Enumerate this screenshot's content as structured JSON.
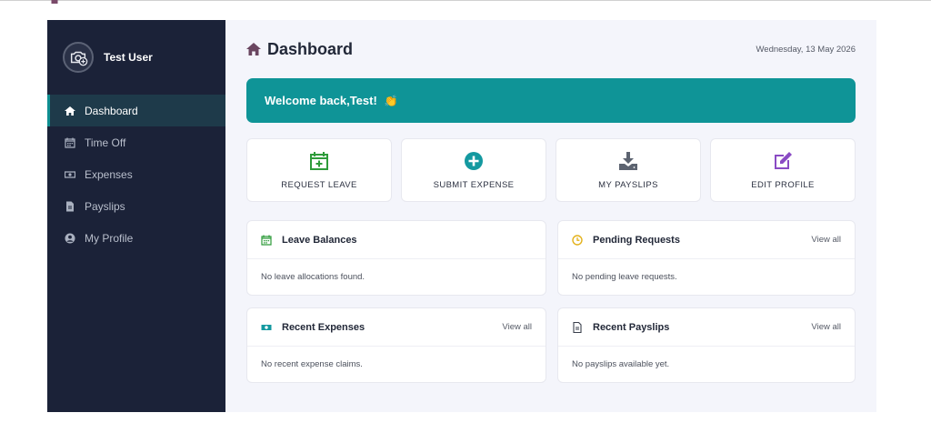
{
  "sidebar": {
    "user_name": "Test User",
    "items": [
      {
        "label": "Dashboard",
        "icon": "home-icon",
        "active": true
      },
      {
        "label": "Time Off",
        "icon": "calendar-icon",
        "active": false
      },
      {
        "label": "Expenses",
        "icon": "money-icon",
        "active": false
      },
      {
        "label": "Payslips",
        "icon": "document-icon",
        "active": false
      },
      {
        "label": "My Profile",
        "icon": "user-circle-icon",
        "active": false
      }
    ]
  },
  "header": {
    "title": "Dashboard",
    "date": "Wednesday, 13 May 2026"
  },
  "welcome": {
    "text": "Welcome back,Test!",
    "emoji": "👏"
  },
  "actions": [
    {
      "label": "REQUEST LEAVE",
      "icon": "calendar-plus-icon",
      "color": "#2e9b3a"
    },
    {
      "label": "SUBMIT EXPENSE",
      "icon": "plus-circle-icon",
      "color": "#1499a0"
    },
    {
      "label": "MY PAYSLIPS",
      "icon": "download-icon",
      "color": "#5c6370"
    },
    {
      "label": "EDIT PROFILE",
      "icon": "edit-icon",
      "color": "#8a4bc4"
    }
  ],
  "cards": {
    "leave_balances": {
      "title": "Leave Balances",
      "body": "No leave allocations found."
    },
    "pending_requests": {
      "title": "Pending Requests",
      "view_all": "View all",
      "body": "No pending leave requests."
    },
    "recent_expenses": {
      "title": "Recent Expenses",
      "view_all": "View all",
      "body": "No recent expense claims."
    },
    "recent_payslips": {
      "title": "Recent Payslips",
      "view_all": "View all",
      "body": "No payslips available yet."
    }
  },
  "colors": {
    "sidebar_bg": "#1b2238",
    "accent": "#0f9497",
    "main_bg": "#f4f5fb"
  }
}
